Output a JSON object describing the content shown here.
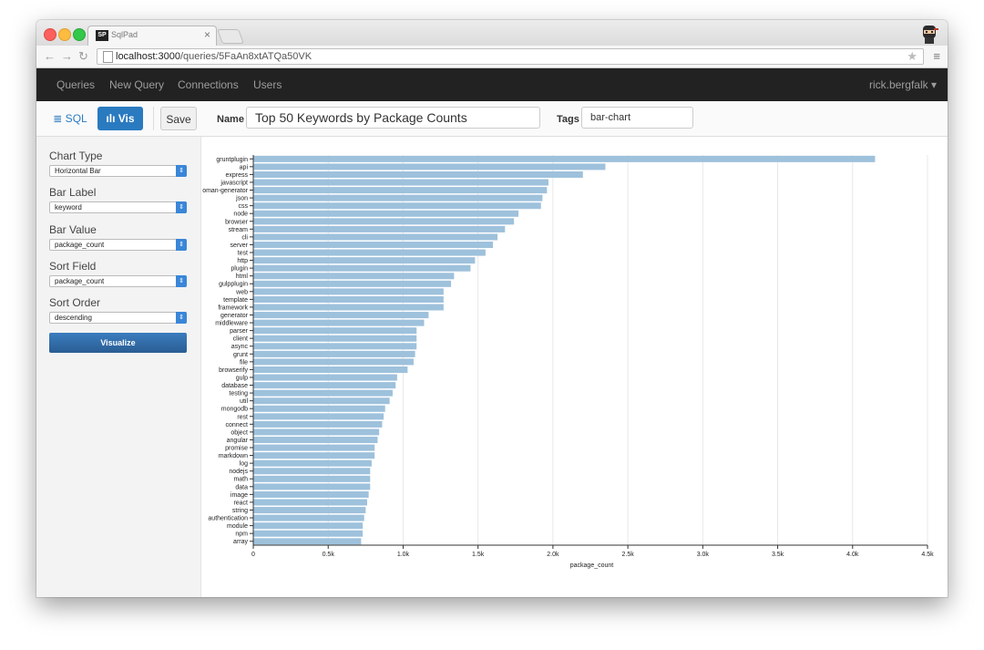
{
  "browser": {
    "tab_favicon": "SP",
    "tab_title": "SqlPad",
    "tab_close": "×",
    "url_host": "localhost:3000",
    "url_path": "/queries/5FaAn8xtATQa50VK"
  },
  "nav": {
    "links": [
      "Queries",
      "New Query",
      "Connections",
      "Users"
    ],
    "user": "rick.bergfalk ▾"
  },
  "toolbar": {
    "sql_label": "≣ SQL",
    "vis_label": "ılı Vis",
    "save_label": "Save",
    "name_label": "Name",
    "name_value": "Top 50 Keywords by Package Counts",
    "tags_label": "Tags",
    "tags_value": "bar-chart"
  },
  "sidebar": {
    "chart_type_label": "Chart Type",
    "chart_type_value": "Horizontal Bar",
    "bar_label_label": "Bar Label",
    "bar_label_value": "keyword",
    "bar_value_label": "Bar Value",
    "bar_value_value": "package_count",
    "sort_field_label": "Sort Field",
    "sort_field_value": "package_count",
    "sort_order_label": "Sort Order",
    "sort_order_value": "descending",
    "visualize_label": "Visualize"
  },
  "chart_data": {
    "type": "bar",
    "orientation": "horizontal",
    "bar_color": "#9ec1dc",
    "xlabel": "package_count",
    "xlim": [
      0,
      4500
    ],
    "xticks": [
      0,
      500,
      1000,
      1500,
      2000,
      2500,
      3000,
      3500,
      4000,
      4500
    ],
    "xtick_labels": [
      "0",
      "0.5k",
      "1.0k",
      "1.5k",
      "2.0k",
      "2.5k",
      "3.0k",
      "3.5k",
      "4.0k",
      "4.5k"
    ],
    "grid": "vertical",
    "categories": [
      "gruntplugin",
      "api",
      "express",
      "javascript",
      "oman-generator",
      "json",
      "css",
      "node",
      "browser",
      "stream",
      "cli",
      "server",
      "test",
      "http",
      "plugin",
      "html",
      "gulpplugin",
      "web",
      "template",
      "framework",
      "generator",
      "middleware",
      "parser",
      "client",
      "async",
      "grunt",
      "file",
      "browserify",
      "gulp",
      "database",
      "testing",
      "util",
      "mongodb",
      "rest",
      "connect",
      "object",
      "angular",
      "promise",
      "markdown",
      "log",
      "nodejs",
      "math",
      "data",
      "image",
      "react",
      "string",
      "authentication",
      "module",
      "npm",
      "array"
    ],
    "values": [
      4150,
      2350,
      2200,
      1970,
      1960,
      1930,
      1920,
      1770,
      1740,
      1680,
      1630,
      1600,
      1550,
      1480,
      1450,
      1340,
      1320,
      1270,
      1270,
      1270,
      1170,
      1140,
      1090,
      1090,
      1090,
      1080,
      1070,
      1030,
      960,
      950,
      930,
      910,
      880,
      870,
      860,
      840,
      830,
      810,
      810,
      790,
      780,
      780,
      780,
      770,
      760,
      750,
      740,
      730,
      730,
      720
    ]
  }
}
